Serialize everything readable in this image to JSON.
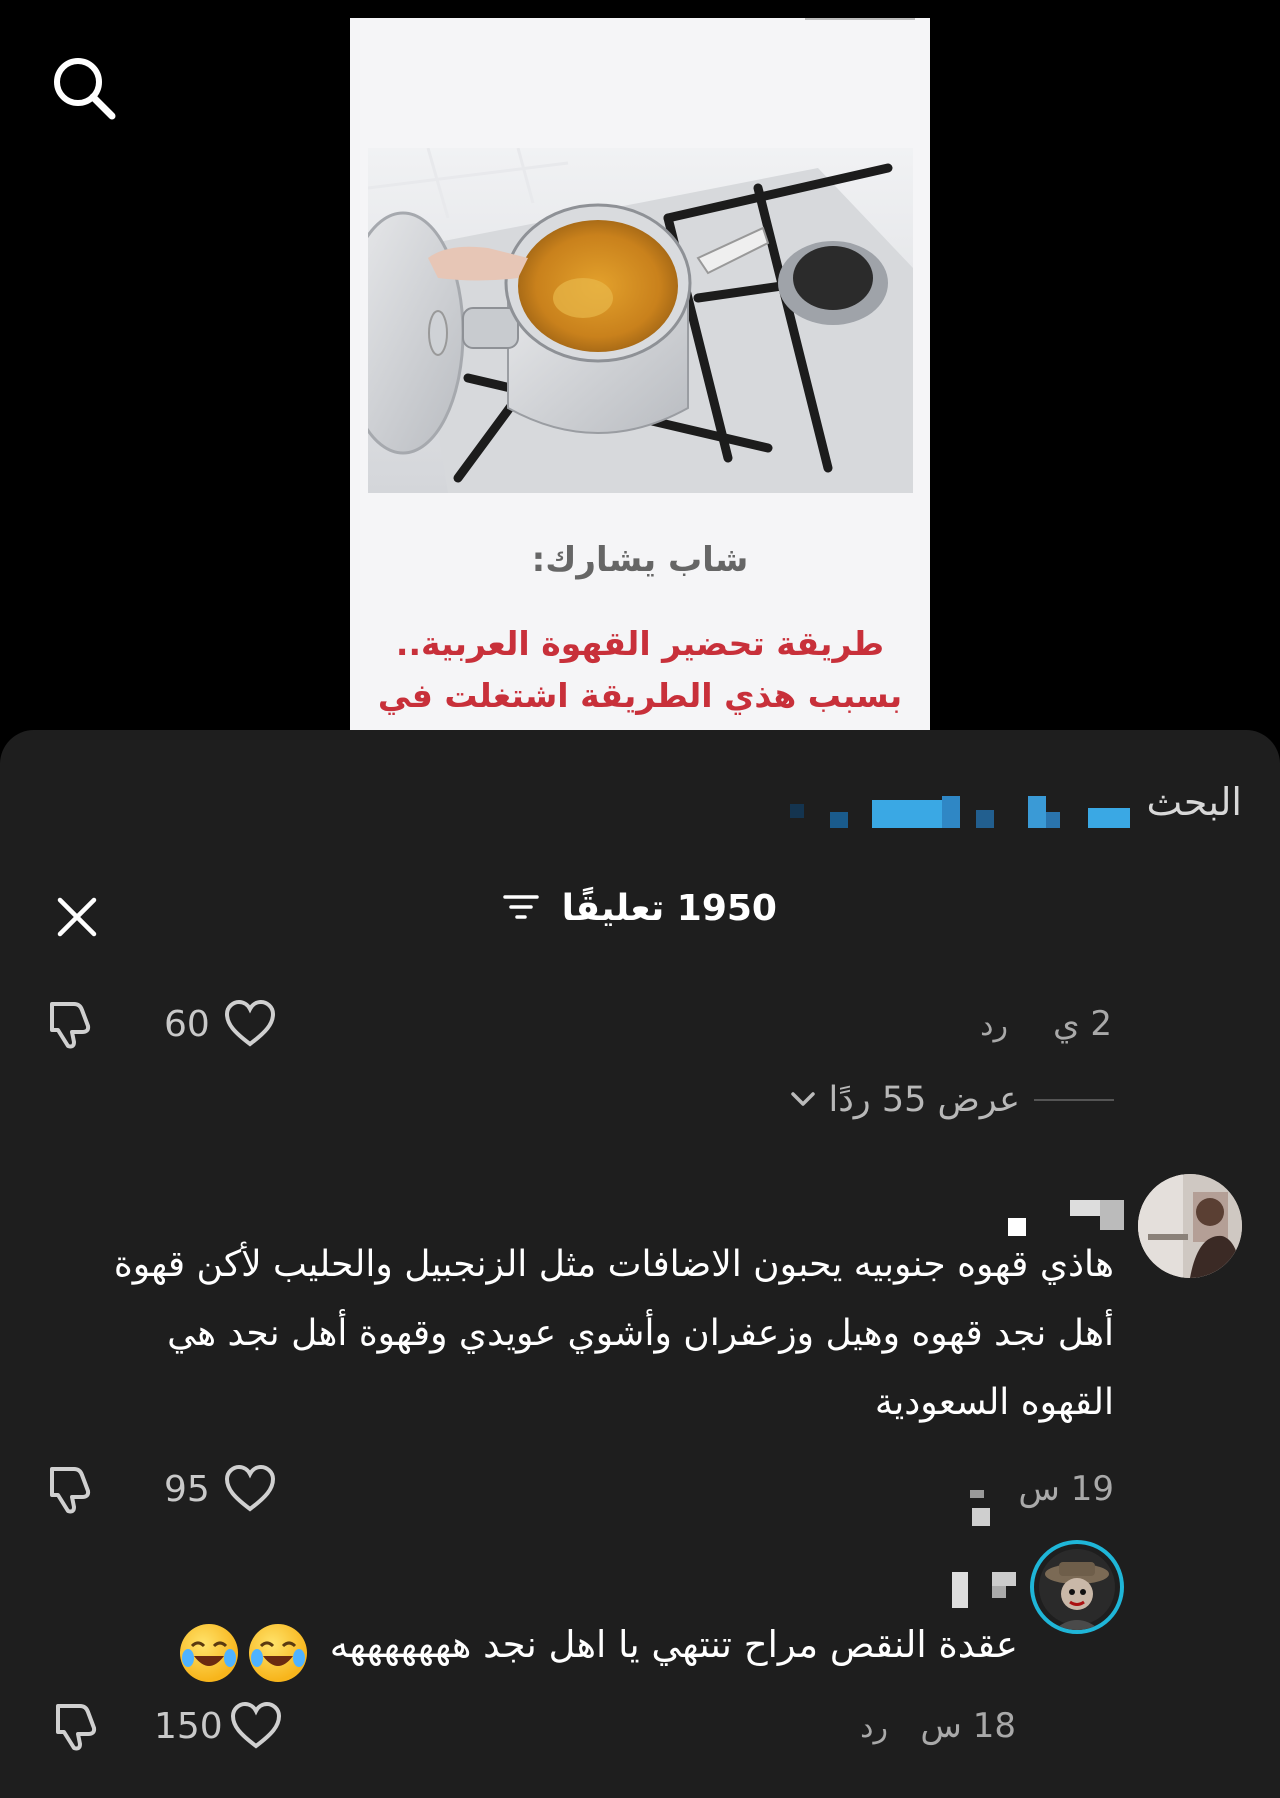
{
  "post": {
    "subtitle": "شاب يشارك:",
    "headline": "طريقة تحضير القهوة العربية.. بسبب هذي الطريقة اشتغلت في"
  },
  "search": {
    "label": "البحث"
  },
  "comments_sheet": {
    "count": "1950",
    "count_label": "تعليقًا"
  },
  "comments": [
    {
      "time": "2 ي",
      "reply_label": "رد",
      "likes": "60",
      "view_replies": "عرض 55 ردًا"
    },
    {
      "text": "هاذي قهوه جنوبيه يحبون الاضافات مثل الزنجبيل والحليب لأكن قهوة أهل نجد قهوه وهيل وزعفران وأشوي عويدي وقهوة أهل نجد هي القهوه السعودية",
      "time": "19 س",
      "likes": "95"
    },
    {
      "text": "عقدة النقص مراح تنتهي يا اهل نجد هههههههه",
      "time": "18 س",
      "reply_label": "رد",
      "likes": "150"
    }
  ],
  "colors": {
    "sheet_bg": "#1e1e1e",
    "headline_red": "#c8303a",
    "story_ring": "#1fb6d8"
  }
}
